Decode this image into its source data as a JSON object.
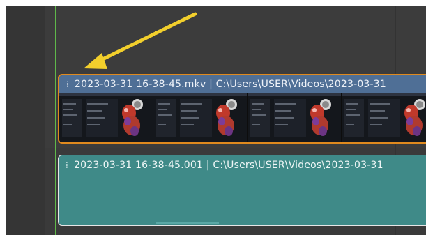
{
  "timeline": {
    "colors": {
      "playhead": "#5fb84a",
      "movie_strip": "#4f6f96",
      "sound_strip": "#3f8a88",
      "selection_outline": "#e08a1e",
      "annotation_arrow": "#f2cf2c"
    },
    "strips": {
      "movie": {
        "label": "2023-03-31 16-38-45.mkv | C:\\Users\\USER\\Videos\\2023-03-31",
        "selected": true,
        "grip_icon": "drag-handle-icon"
      },
      "sound": {
        "label": "2023-03-31 16-38-45.001 | C:\\Users\\USER\\Videos\\2023-03-31",
        "grip_icon": "drag-handle-icon"
      }
    },
    "annotation": {
      "icon": "arrow-icon"
    }
  }
}
